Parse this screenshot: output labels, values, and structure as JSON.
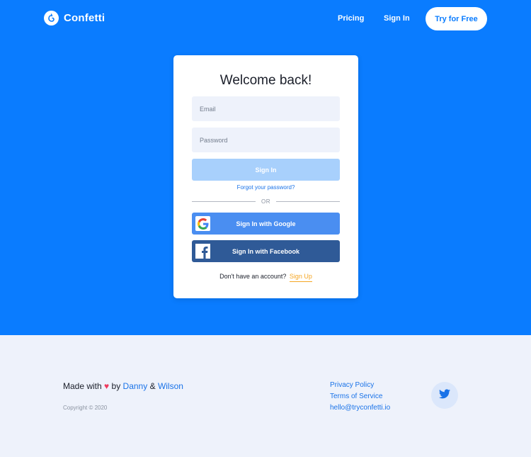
{
  "nav": {
    "logo_text": "Confetti",
    "logo_icon": "confetti-logo-icon",
    "pricing": "Pricing",
    "sign_in": "Sign In",
    "try_free": "Try for Free"
  },
  "card": {
    "title": "Welcome back!",
    "email_placeholder": "Email",
    "password_placeholder": "Password",
    "sign_in_button": "Sign In",
    "forgot": "Forgot your password?",
    "or": "OR",
    "google_button": "Sign In with Google",
    "facebook_button": "Sign In with Facebook",
    "no_account": "Don't have an account?",
    "sign_up": "Sign Up"
  },
  "footer": {
    "made_with": "Made with",
    "by": "by",
    "author1": "Danny",
    "amp": "&",
    "author2": "Wilson",
    "copyright": "Copyright © 2020",
    "links": [
      "Privacy Policy",
      "Terms of Service",
      "hello@tryconfetti.io"
    ]
  },
  "colors": {
    "brand_blue": "#0a7cff",
    "google_blue": "#4a8ef1",
    "facebook_blue": "#2f5a97",
    "accent_orange": "#f5a623",
    "heart_red": "#ef3a5d"
  },
  "icons": [
    "confetti-logo-icon",
    "google-icon",
    "facebook-icon",
    "heart-icon",
    "twitter-icon"
  ]
}
